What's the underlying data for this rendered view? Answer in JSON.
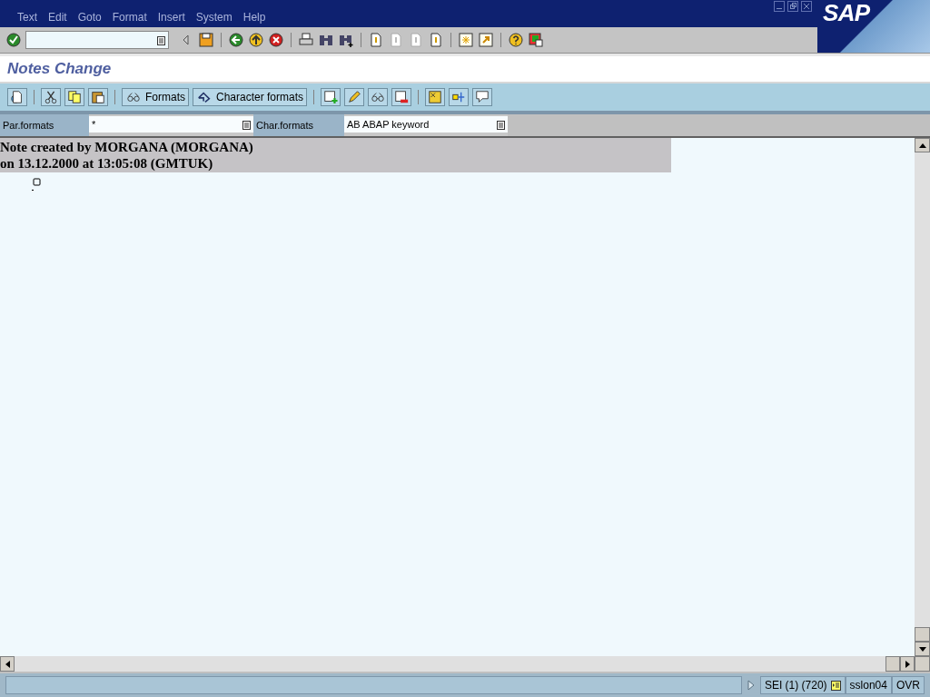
{
  "menu": [
    "Text",
    "Edit",
    "Goto",
    "Format",
    "Insert",
    "System",
    "Help"
  ],
  "logo": "SAP",
  "screen_title": "Notes Change",
  "app_toolbar": {
    "buttons": [
      {
        "label": "Formats"
      },
      {
        "label": "Character formats"
      }
    ]
  },
  "format_fields": [
    {
      "label": "Par.formats",
      "value": "*"
    },
    {
      "label": "Char.formats",
      "value": "AB ABAP keyword"
    }
  ],
  "editor": {
    "header_lines": [
      "Note created by MORGANA (MORGANA)",
      "on 13.12.2000 at 13:05:08 (GMTUK)"
    ]
  },
  "status_bar": {
    "session": "SEI (1) (720)",
    "server": "sslon04",
    "mode": "OVR"
  }
}
